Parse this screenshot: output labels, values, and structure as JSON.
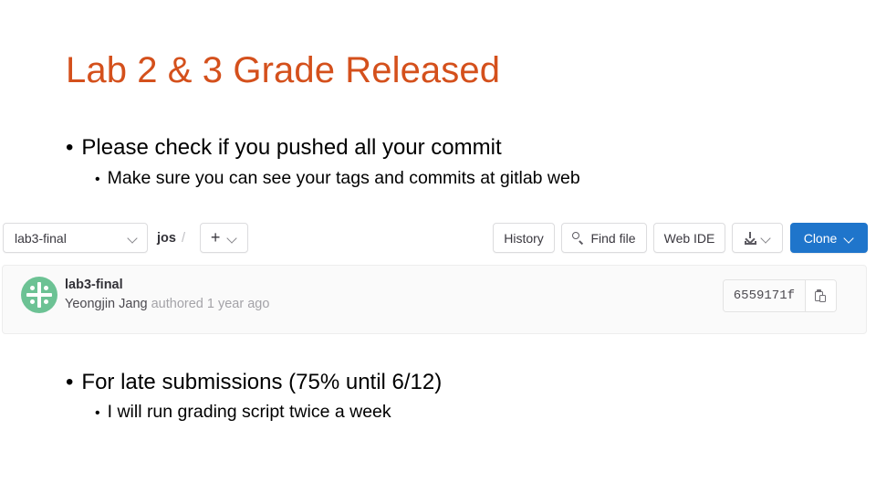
{
  "slide": {
    "title": "Lab 2 & 3 Grade Released",
    "title_color": "#D4501C",
    "bullet_mark": "•",
    "bullets": [
      {
        "level": 1,
        "text": "Please check if you pushed all your commit"
      },
      {
        "level": 2,
        "text": "Make sure you can see your tags and commits at gitlab web"
      },
      {
        "level": 1,
        "text": "For late submissions (75% until 6/12)"
      },
      {
        "level": 2,
        "text": "I will run grading script twice a week"
      }
    ]
  },
  "gitlab": {
    "toolbar": {
      "branch_select": {
        "value": "lab3-final",
        "chevron_icon": "chevron-down-icon"
      },
      "breadcrumb": {
        "repo": "jos",
        "separator": "/"
      },
      "add_button": {
        "plus_label": "+",
        "chevron_icon": "chevron-down-icon"
      },
      "history_label": "History",
      "find_file_label": "Find file",
      "find_file_icon": "search-icon",
      "web_ide_label": "Web IDE",
      "download_icon": "download-icon",
      "download_chevron_icon": "chevron-down-icon",
      "clone_label": "Clone",
      "clone_chevron_icon": "chevron-down-icon",
      "clone_color": "#1F75CB"
    },
    "commit": {
      "avatar_icon": "identicon-avatar",
      "avatar_color": "#6CC294",
      "title": "lab3-final",
      "author": "Yeongjin Jang",
      "authored_text": "authored 1 year ago",
      "sha": "6559171f",
      "copy_icon": "clipboard-icon"
    }
  }
}
